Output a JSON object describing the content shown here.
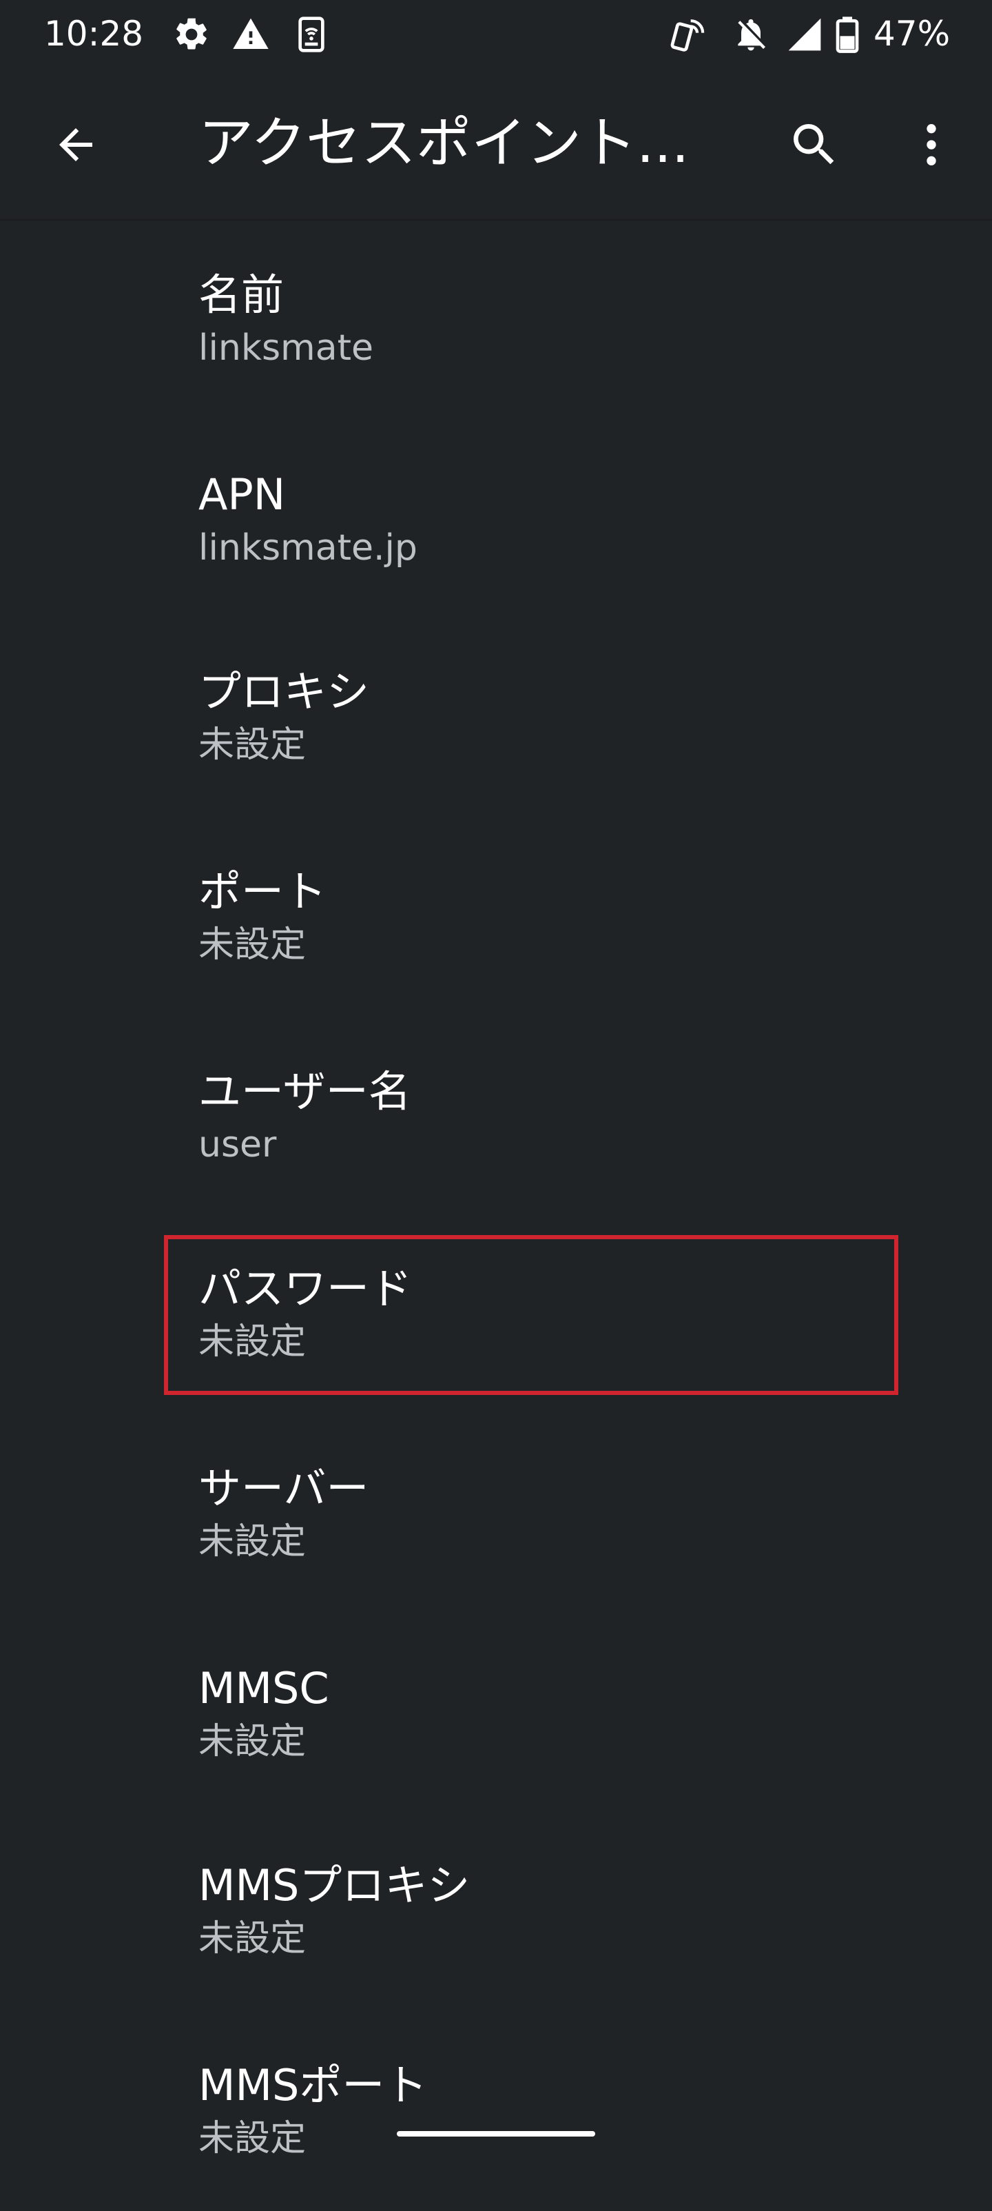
{
  "status_bar": {
    "time": "10:28",
    "icons": [
      "gear-icon",
      "alert-triangle-icon",
      "sim-wifi-icon",
      "nfc-phone-icon",
      "bell-off-icon",
      "signal-icon",
      "battery-icon"
    ],
    "battery_percent": "47%"
  },
  "app_bar": {
    "title": "アクセスポイント...",
    "back_icon": "arrow-left-icon",
    "search_icon": "search-icon",
    "more_icon": "more-vert-icon"
  },
  "items": [
    {
      "title": "名前",
      "summary": "linksmate"
    },
    {
      "title": "APN",
      "summary": "linksmate.jp"
    },
    {
      "title": "プロキシ",
      "summary": "未設定"
    },
    {
      "title": "ポート",
      "summary": "未設定"
    },
    {
      "title": "ユーザー名",
      "summary": "user"
    },
    {
      "title": "パスワード",
      "summary": "未設定"
    },
    {
      "title": "サーバー",
      "summary": "未設定"
    },
    {
      "title": "MMSC",
      "summary": "未設定"
    },
    {
      "title": "MMSプロキシ",
      "summary": "未設定"
    },
    {
      "title": "MMSポート",
      "summary": "未設定"
    }
  ],
  "colors": {
    "background": "#202326",
    "title_text": "#ffffff",
    "summary_text": "#bdc1c6",
    "highlight": "#d0242e"
  }
}
